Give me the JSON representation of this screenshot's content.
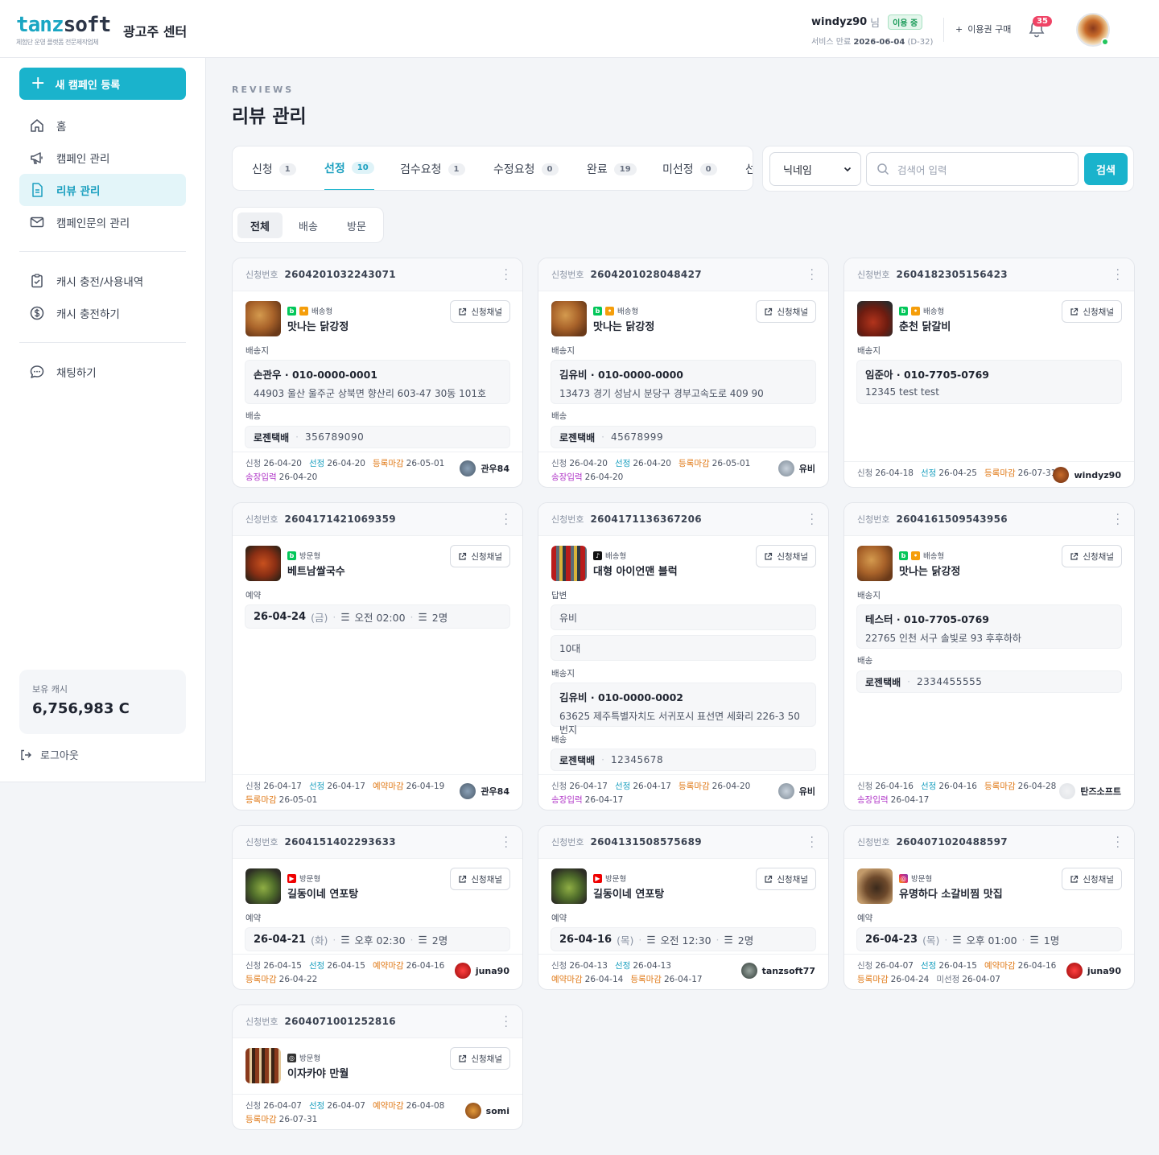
{
  "brand": {
    "logo_a": "tanz",
    "logo_b": "soft",
    "tagline": "체험단 운영 플랫폼 전문제작업체",
    "center": "광고주 센터"
  },
  "user": {
    "name": "windyz90",
    "honorific": "님",
    "status": "이용 중",
    "service_label": "서비스 만료",
    "service_date": "2026-06-04",
    "service_dday": "(D-32)"
  },
  "header": {
    "buy_label": "이용권 구매",
    "notif_count": "35"
  },
  "sidebar": {
    "new_campaign": "새 캠페인 등록",
    "items": [
      {
        "label": "홈",
        "icon": "home-icon"
      },
      {
        "label": "캠페인 관리",
        "icon": "megaphone-icon"
      },
      {
        "label": "리뷰 관리",
        "icon": "document-icon"
      },
      {
        "label": "캠페인문의 관리",
        "icon": "mail-icon"
      }
    ],
    "items2": [
      {
        "label": "캐시 충전/사용내역",
        "icon": "clipboard-check-icon"
      },
      {
        "label": "캐시 충전하기",
        "icon": "dollar-icon"
      }
    ],
    "items3": [
      {
        "label": "채팅하기",
        "icon": "chat-icon"
      }
    ],
    "cash_label": "보유 캐시",
    "cash_value": "6,756,983 C",
    "logout": "로그아웃"
  },
  "page": {
    "eyebrow": "REVIEWS",
    "title": "리뷰 관리"
  },
  "tabs": [
    {
      "label": "신청",
      "count": "1"
    },
    {
      "label": "선정",
      "count": "10"
    },
    {
      "label": "검수요청",
      "count": "1"
    },
    {
      "label": "수정요청",
      "count": "0"
    },
    {
      "label": "완료",
      "count": "19"
    },
    {
      "label": "미선정",
      "count": "0"
    },
    {
      "label": "선",
      "count": ""
    }
  ],
  "search": {
    "select": "닉네임",
    "placeholder": "검색어 입력",
    "button": "검색"
  },
  "filters": [
    "전체",
    "배송",
    "방문"
  ],
  "labels": {
    "app_no": "신청번호",
    "channel": "신청채널",
    "ship_to": "배송지",
    "ship": "배송",
    "reserve": "예약",
    "answer": "답변",
    "f_apply": "신청",
    "f_select": "선정",
    "f_reg": "등록마감",
    "f_track": "송장입력",
    "f_rsv": "예약마감",
    "f_unsel": "미선정"
  },
  "cards": [
    {
      "no": "2604201032243071",
      "type": "배송형",
      "name": "맛나는 닭강정",
      "recv": "손관우 · 010-0000-0001",
      "addr": "44903 울산 울주군 상북면 향산리 603-47 30동 101호",
      "courier": "로젠택배",
      "tracking": "356789090",
      "apply": "26-04-20",
      "select": "26-04-20",
      "reg": "26-05-01",
      "track": "26-04-20",
      "user": "관우84"
    },
    {
      "no": "2604201028048427",
      "type": "배송형",
      "name": "맛나는 닭강정",
      "recv": "김유비 · 010-0000-0000",
      "addr": "13473 경기 성남시 분당구 경부고속도로 409 90",
      "courier": "로젠택배",
      "tracking": "45678999",
      "apply": "26-04-20",
      "select": "26-04-20",
      "reg": "26-05-01",
      "track": "26-04-20",
      "user": "유비"
    },
    {
      "no": "2604182305156423",
      "type": "배송형",
      "name": "춘천 닭갈비",
      "recv": "임준아 · 010-7705-0769",
      "addr": "12345 test test",
      "apply": "26-04-18",
      "select": "26-04-25",
      "reg": "26-07-31",
      "user": "windyz90"
    },
    {
      "no": "2604171421069359",
      "type": "방문형",
      "name": "베트남쌀국수",
      "date": "26-04-24",
      "wday": "(금)",
      "time": "오전 02:00",
      "ppl": "2명",
      "apply": "26-04-17",
      "select": "26-04-17",
      "rsv": "26-04-19",
      "reg": "26-05-01",
      "user": "관우84"
    },
    {
      "no": "2604171136367206",
      "type": "배송형",
      "name": "대형 아이언맨 블럭",
      "ans1": "유비",
      "ans2": "10대",
      "recv": "김유비 · 010-0000-0002",
      "addr": "63625 제주특별자치도 서귀포시 표선면 세화리 226-3 50번지",
      "courier": "로젠택배",
      "tracking": "12345678",
      "apply": "26-04-17",
      "select": "26-04-17",
      "reg": "26-04-20",
      "track": "26-04-17",
      "user": "유비"
    },
    {
      "no": "2604161509543956",
      "type": "배송형",
      "name": "맛나는 닭강정",
      "recv": "테스터 · 010-7705-0769",
      "addr": "22765 인천 서구 솔빛로 93 후후하하",
      "courier": "로젠택배",
      "tracking": "2334455555",
      "apply": "26-04-16",
      "select": "26-04-16",
      "reg": "26-04-28",
      "track": "26-04-17",
      "user": "탄즈소프트"
    },
    {
      "no": "2604151402293633",
      "type": "방문형",
      "name": "길동이네 연포탕",
      "date": "26-04-21",
      "wday": "(화)",
      "time": "오후 02:30",
      "ppl": "2명",
      "apply": "26-04-15",
      "select": "26-04-15",
      "rsv": "26-04-16",
      "reg": "26-04-22",
      "user": "juna90"
    },
    {
      "no": "2604131508575689",
      "type": "방문형",
      "name": "길동이네 연포탕",
      "date": "26-04-16",
      "wday": "(목)",
      "time": "오전 12:30",
      "ppl": "2명",
      "apply": "26-04-13",
      "select": "26-04-13",
      "rsv": "26-04-14",
      "reg": "26-04-17",
      "user": "tanzsoft77"
    },
    {
      "no": "2604071020488597",
      "type": "방문형",
      "name": "유명하다 소갈비찜 맛집",
      "date": "26-04-23",
      "wday": "(목)",
      "time": "오후 01:00",
      "ppl": "1명",
      "apply": "26-04-07",
      "select": "26-04-15",
      "rsv": "26-04-16",
      "reg": "26-04-24",
      "unsel": "26-04-07",
      "user": "juna90"
    },
    {
      "no": "2604071001252816",
      "type": "방문형",
      "name": "이자카야 만월",
      "apply": "26-04-07",
      "select": "26-04-07",
      "rsv": "26-04-08",
      "reg": "26-07-31",
      "user": "somi"
    }
  ]
}
